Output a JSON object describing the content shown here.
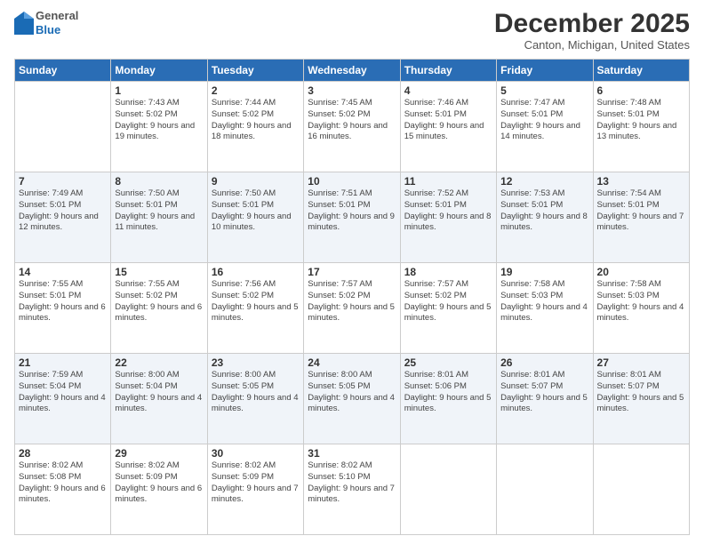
{
  "logo": {
    "general": "General",
    "blue": "Blue"
  },
  "title": "December 2025",
  "location": "Canton, Michigan, United States",
  "days_header": [
    "Sunday",
    "Monday",
    "Tuesday",
    "Wednesday",
    "Thursday",
    "Friday",
    "Saturday"
  ],
  "weeks": [
    [
      {
        "day": "",
        "sunrise": "",
        "sunset": "",
        "daylight": ""
      },
      {
        "day": "1",
        "sunrise": "Sunrise: 7:43 AM",
        "sunset": "Sunset: 5:02 PM",
        "daylight": "Daylight: 9 hours and 19 minutes."
      },
      {
        "day": "2",
        "sunrise": "Sunrise: 7:44 AM",
        "sunset": "Sunset: 5:02 PM",
        "daylight": "Daylight: 9 hours and 18 minutes."
      },
      {
        "day": "3",
        "sunrise": "Sunrise: 7:45 AM",
        "sunset": "Sunset: 5:02 PM",
        "daylight": "Daylight: 9 hours and 16 minutes."
      },
      {
        "day": "4",
        "sunrise": "Sunrise: 7:46 AM",
        "sunset": "Sunset: 5:01 PM",
        "daylight": "Daylight: 9 hours and 15 minutes."
      },
      {
        "day": "5",
        "sunrise": "Sunrise: 7:47 AM",
        "sunset": "Sunset: 5:01 PM",
        "daylight": "Daylight: 9 hours and 14 minutes."
      },
      {
        "day": "6",
        "sunrise": "Sunrise: 7:48 AM",
        "sunset": "Sunset: 5:01 PM",
        "daylight": "Daylight: 9 hours and 13 minutes."
      }
    ],
    [
      {
        "day": "7",
        "sunrise": "Sunrise: 7:49 AM",
        "sunset": "Sunset: 5:01 PM",
        "daylight": "Daylight: 9 hours and 12 minutes."
      },
      {
        "day": "8",
        "sunrise": "Sunrise: 7:50 AM",
        "sunset": "Sunset: 5:01 PM",
        "daylight": "Daylight: 9 hours and 11 minutes."
      },
      {
        "day": "9",
        "sunrise": "Sunrise: 7:50 AM",
        "sunset": "Sunset: 5:01 PM",
        "daylight": "Daylight: 9 hours and 10 minutes."
      },
      {
        "day": "10",
        "sunrise": "Sunrise: 7:51 AM",
        "sunset": "Sunset: 5:01 PM",
        "daylight": "Daylight: 9 hours and 9 minutes."
      },
      {
        "day": "11",
        "sunrise": "Sunrise: 7:52 AM",
        "sunset": "Sunset: 5:01 PM",
        "daylight": "Daylight: 9 hours and 8 minutes."
      },
      {
        "day": "12",
        "sunrise": "Sunrise: 7:53 AM",
        "sunset": "Sunset: 5:01 PM",
        "daylight": "Daylight: 9 hours and 8 minutes."
      },
      {
        "day": "13",
        "sunrise": "Sunrise: 7:54 AM",
        "sunset": "Sunset: 5:01 PM",
        "daylight": "Daylight: 9 hours and 7 minutes."
      }
    ],
    [
      {
        "day": "14",
        "sunrise": "Sunrise: 7:55 AM",
        "sunset": "Sunset: 5:01 PM",
        "daylight": "Daylight: 9 hours and 6 minutes."
      },
      {
        "day": "15",
        "sunrise": "Sunrise: 7:55 AM",
        "sunset": "Sunset: 5:02 PM",
        "daylight": "Daylight: 9 hours and 6 minutes."
      },
      {
        "day": "16",
        "sunrise": "Sunrise: 7:56 AM",
        "sunset": "Sunset: 5:02 PM",
        "daylight": "Daylight: 9 hours and 5 minutes."
      },
      {
        "day": "17",
        "sunrise": "Sunrise: 7:57 AM",
        "sunset": "Sunset: 5:02 PM",
        "daylight": "Daylight: 9 hours and 5 minutes."
      },
      {
        "day": "18",
        "sunrise": "Sunrise: 7:57 AM",
        "sunset": "Sunset: 5:02 PM",
        "daylight": "Daylight: 9 hours and 5 minutes."
      },
      {
        "day": "19",
        "sunrise": "Sunrise: 7:58 AM",
        "sunset": "Sunset: 5:03 PM",
        "daylight": "Daylight: 9 hours and 4 minutes."
      },
      {
        "day": "20",
        "sunrise": "Sunrise: 7:58 AM",
        "sunset": "Sunset: 5:03 PM",
        "daylight": "Daylight: 9 hours and 4 minutes."
      }
    ],
    [
      {
        "day": "21",
        "sunrise": "Sunrise: 7:59 AM",
        "sunset": "Sunset: 5:04 PM",
        "daylight": "Daylight: 9 hours and 4 minutes."
      },
      {
        "day": "22",
        "sunrise": "Sunrise: 8:00 AM",
        "sunset": "Sunset: 5:04 PM",
        "daylight": "Daylight: 9 hours and 4 minutes."
      },
      {
        "day": "23",
        "sunrise": "Sunrise: 8:00 AM",
        "sunset": "Sunset: 5:05 PM",
        "daylight": "Daylight: 9 hours and 4 minutes."
      },
      {
        "day": "24",
        "sunrise": "Sunrise: 8:00 AM",
        "sunset": "Sunset: 5:05 PM",
        "daylight": "Daylight: 9 hours and 4 minutes."
      },
      {
        "day": "25",
        "sunrise": "Sunrise: 8:01 AM",
        "sunset": "Sunset: 5:06 PM",
        "daylight": "Daylight: 9 hours and 5 minutes."
      },
      {
        "day": "26",
        "sunrise": "Sunrise: 8:01 AM",
        "sunset": "Sunset: 5:07 PM",
        "daylight": "Daylight: 9 hours and 5 minutes."
      },
      {
        "day": "27",
        "sunrise": "Sunrise: 8:01 AM",
        "sunset": "Sunset: 5:07 PM",
        "daylight": "Daylight: 9 hours and 5 minutes."
      }
    ],
    [
      {
        "day": "28",
        "sunrise": "Sunrise: 8:02 AM",
        "sunset": "Sunset: 5:08 PM",
        "daylight": "Daylight: 9 hours and 6 minutes."
      },
      {
        "day": "29",
        "sunrise": "Sunrise: 8:02 AM",
        "sunset": "Sunset: 5:09 PM",
        "daylight": "Daylight: 9 hours and 6 minutes."
      },
      {
        "day": "30",
        "sunrise": "Sunrise: 8:02 AM",
        "sunset": "Sunset: 5:09 PM",
        "daylight": "Daylight: 9 hours and 7 minutes."
      },
      {
        "day": "31",
        "sunrise": "Sunrise: 8:02 AM",
        "sunset": "Sunset: 5:10 PM",
        "daylight": "Daylight: 9 hours and 7 minutes."
      },
      {
        "day": "",
        "sunrise": "",
        "sunset": "",
        "daylight": ""
      },
      {
        "day": "",
        "sunrise": "",
        "sunset": "",
        "daylight": ""
      },
      {
        "day": "",
        "sunrise": "",
        "sunset": "",
        "daylight": ""
      }
    ]
  ]
}
